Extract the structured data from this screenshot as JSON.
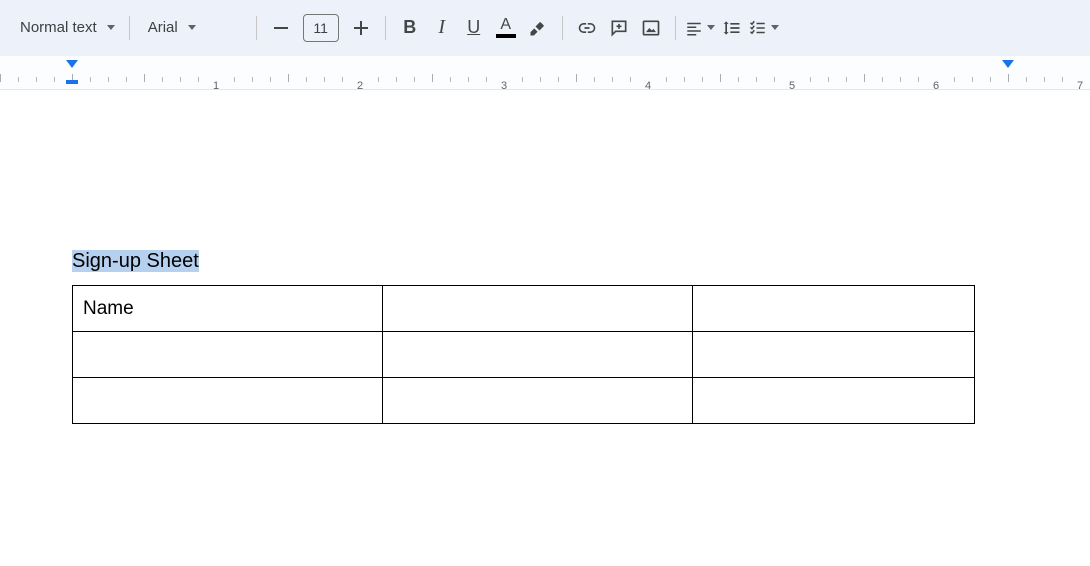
{
  "toolbar": {
    "style_dropdown": "Normal text",
    "font_dropdown": "Arial",
    "font_size": "11"
  },
  "ruler": {
    "labels": [
      "1",
      "2",
      "3",
      "4",
      "5",
      "6",
      "7"
    ]
  },
  "document": {
    "title": "Sign-up Sheet",
    "table": {
      "rows": [
        [
          "Name",
          "",
          ""
        ],
        [
          "",
          "",
          ""
        ],
        [
          "",
          "",
          ""
        ]
      ]
    }
  }
}
